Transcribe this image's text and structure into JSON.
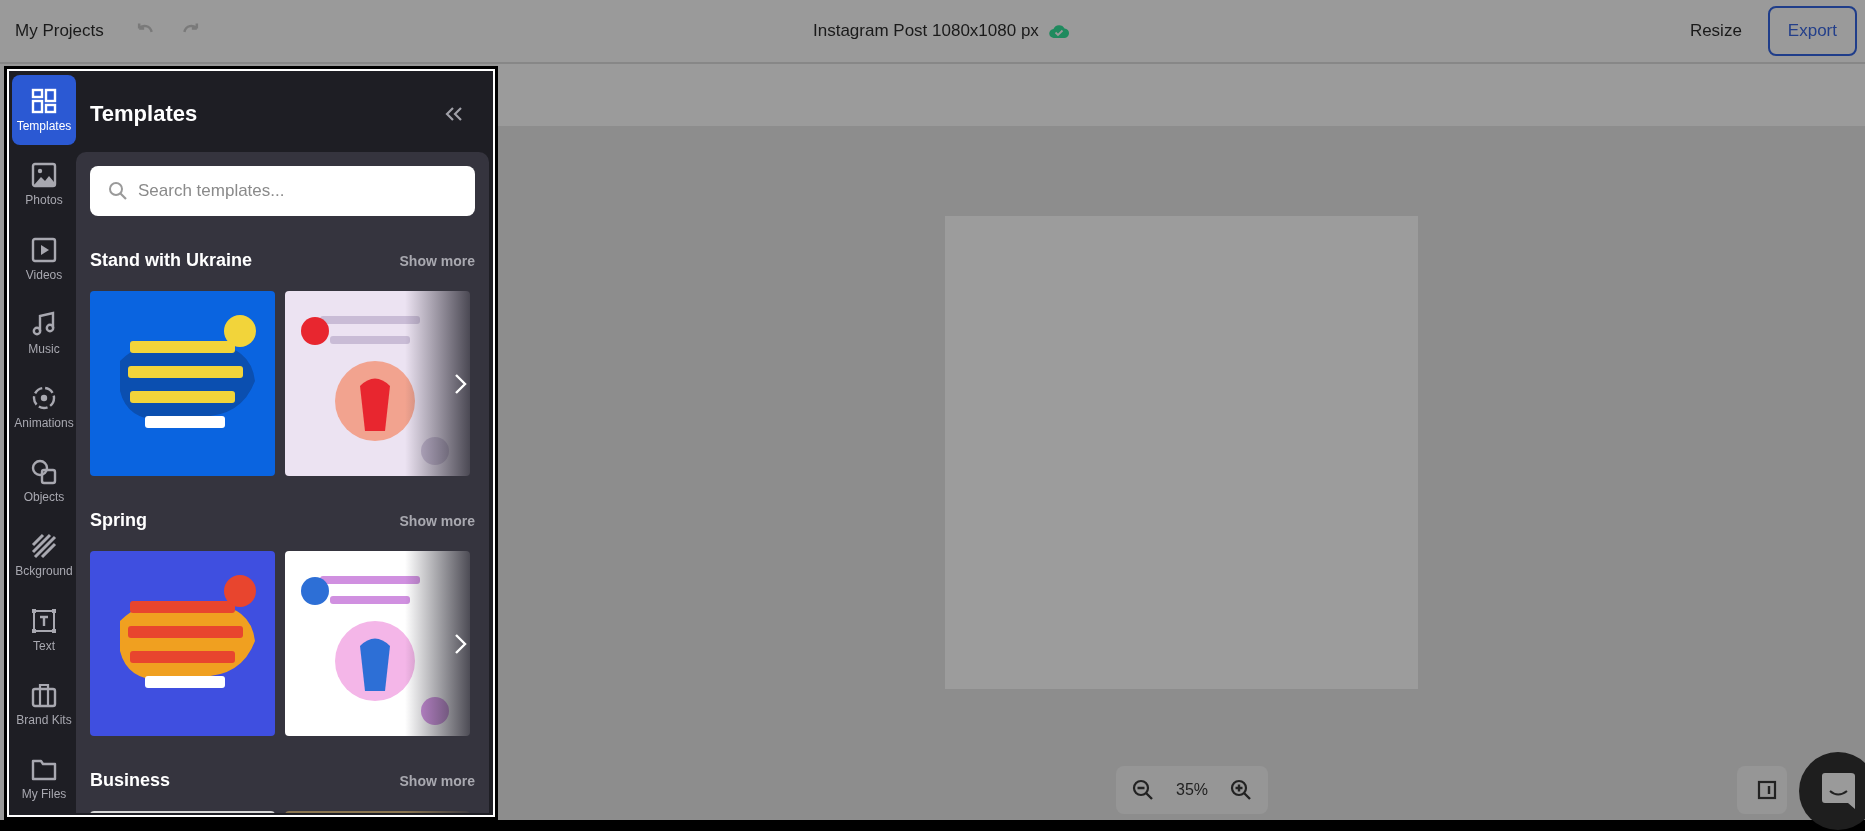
{
  "top_bar": {
    "title": "My Projects",
    "document_title": "Instagram Post 1080x1080 px",
    "resize": "Resize",
    "export": "Export"
  },
  "sidebar": {
    "items": [
      {
        "label": "Templates",
        "selected": true
      },
      {
        "label": "Photos",
        "selected": false
      },
      {
        "label": "Videos",
        "selected": false
      },
      {
        "label": "Music",
        "selected": false
      },
      {
        "label": "Animations",
        "selected": false
      },
      {
        "label": "Objects",
        "selected": false
      },
      {
        "label": "Bckground",
        "selected": false
      },
      {
        "label": "Text",
        "selected": false
      },
      {
        "label": "Brand Kits",
        "selected": false
      },
      {
        "label": "My Files",
        "selected": false
      }
    ]
  },
  "panel": {
    "title": "Templates",
    "search": {
      "placeholder": "Search templates..."
    },
    "sections": [
      {
        "title": "Stand with Ukraine",
        "show_more": "Show more",
        "next_button": true
      },
      {
        "title": "Spring",
        "show_more": "Show more",
        "next_button": true
      },
      {
        "title": "Business",
        "show_more": "Show more",
        "next_button": false
      }
    ]
  },
  "zoom": {
    "value": "35%"
  }
}
